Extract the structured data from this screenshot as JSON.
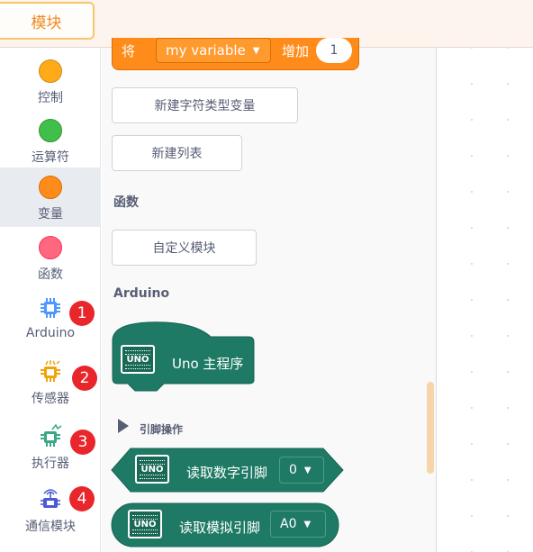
{
  "topbar": {
    "blocks_tab": "模块"
  },
  "categories": [
    {
      "label": "控制",
      "color": "#ffab19",
      "border": "#cf8b17"
    },
    {
      "label": "运算符",
      "color": "#40bf4a",
      "border": "#389438"
    },
    {
      "label": "变量",
      "color": "#ff8c1a",
      "border": "#db6e00",
      "selected": true
    },
    {
      "label": "函数",
      "color": "#ff6680",
      "border": "#ff3355"
    },
    {
      "label": "Arduino",
      "icon": "arduino-chip-icon",
      "color": "#4d97ff"
    },
    {
      "label": "传感器",
      "icon": "sensor-chip-icon",
      "color": "#f0a30a"
    },
    {
      "label": "执行器",
      "icon": "actuator-chip-icon",
      "color": "#3aa886"
    },
    {
      "label": "通信模块",
      "icon": "communication-chip-icon",
      "color": "#4c5bd4"
    }
  ],
  "badges": [
    "1",
    "2",
    "3",
    "4"
  ],
  "palette": {
    "variable_block": {
      "prefix": "将",
      "variable": "my variable",
      "op": "增加",
      "value": "1"
    },
    "new_string_variable": "新建字符类型变量",
    "new_list": "新建列表",
    "functions_heading": "函数",
    "custom_block": "自定义模块",
    "arduino_heading": "Arduino",
    "main_program": "Uno 主程序",
    "pin_ops_heading": "引脚操作",
    "digital_read": {
      "label": "读取数字引脚",
      "pin": "0"
    },
    "analog_read": {
      "label": "读取模拟引脚",
      "pin": "A0"
    },
    "board_label": "UNO"
  }
}
